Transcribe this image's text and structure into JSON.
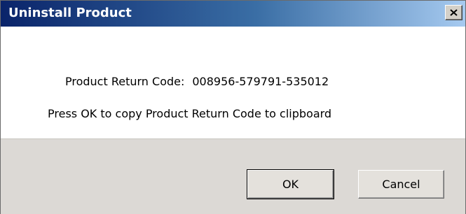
{
  "window": {
    "title": "Uninstall Product",
    "close_icon": "close-x-icon"
  },
  "message": {
    "code_label": "Product Return Code:",
    "code_value": "008956-579791-535012",
    "instruction": "Press OK to copy Product Return Code to clipboard"
  },
  "buttons": {
    "ok_label": "OK",
    "cancel_label": "Cancel"
  },
  "colors": {
    "titlebar_start": "#0a246a",
    "titlebar_end": "#a6caf0",
    "footer_bg": "#dcd9d5",
    "button_face": "#e4e1dc"
  }
}
